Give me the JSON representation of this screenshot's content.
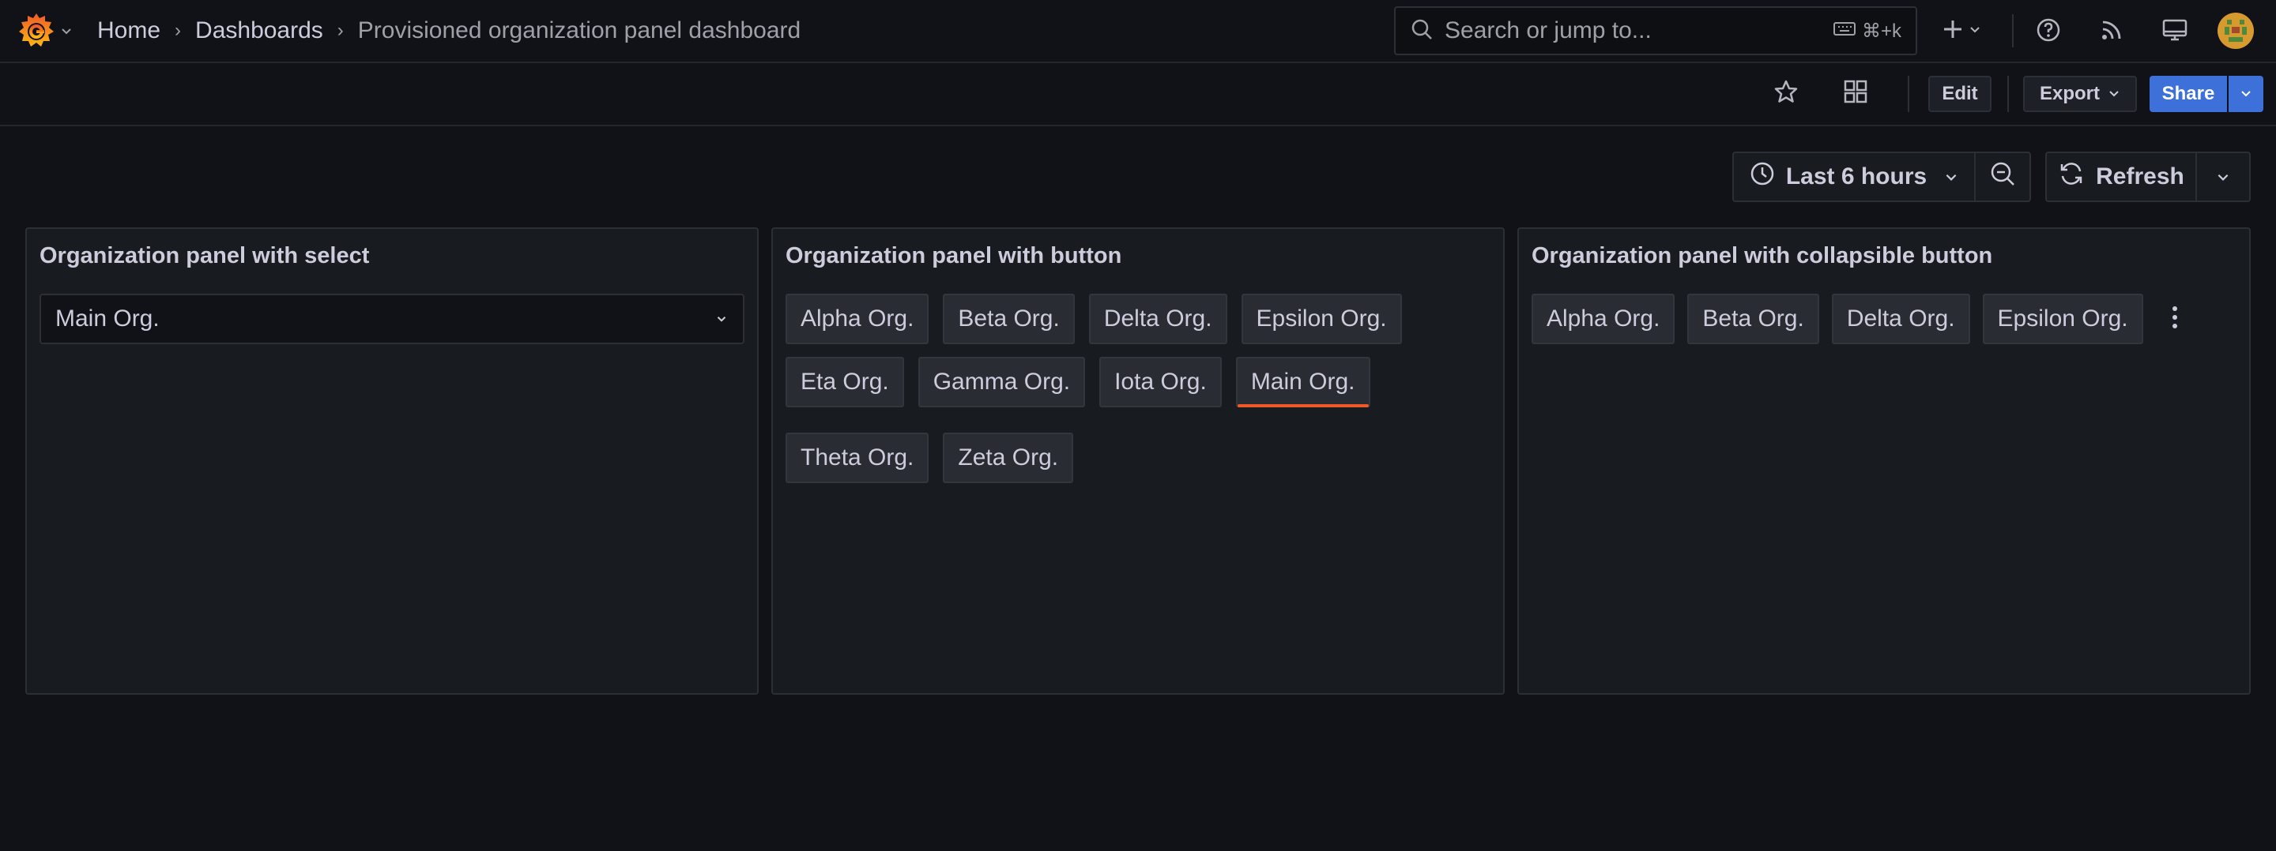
{
  "breadcrumb": {
    "home": "Home",
    "dashboards": "Dashboards",
    "current": "Provisioned organization panel dashboard"
  },
  "search": {
    "placeholder": "Search or jump to...",
    "shortcut": "⌘+k"
  },
  "toolbar": {
    "edit": "Edit",
    "export": "Export",
    "share": "Share"
  },
  "time_controls": {
    "range": "Last 6 hours",
    "refresh": "Refresh"
  },
  "panels": {
    "select_panel": {
      "title": "Organization panel with select",
      "selected": "Main Org."
    },
    "button_panel": {
      "title": "Organization panel with button",
      "orgs": [
        "Alpha Org.",
        "Beta Org.",
        "Delta Org.",
        "Epsilon Org.",
        "Eta Org.",
        "Gamma Org.",
        "Iota Org.",
        "Main Org.",
        "Theta Org.",
        "Zeta Org."
      ],
      "active": "Main Org."
    },
    "collapsible_panel": {
      "title": "Organization panel with collapsible button",
      "orgs": [
        "Alpha Org.",
        "Beta Org.",
        "Delta Org.",
        "Epsilon Org."
      ]
    }
  },
  "colors": {
    "background": "#111217",
    "panel": "#181b1f",
    "border": "#2d2f36",
    "accent_blue": "#3d71d9",
    "active_underline": "#f05a28",
    "logo_orange": "#f46800"
  }
}
